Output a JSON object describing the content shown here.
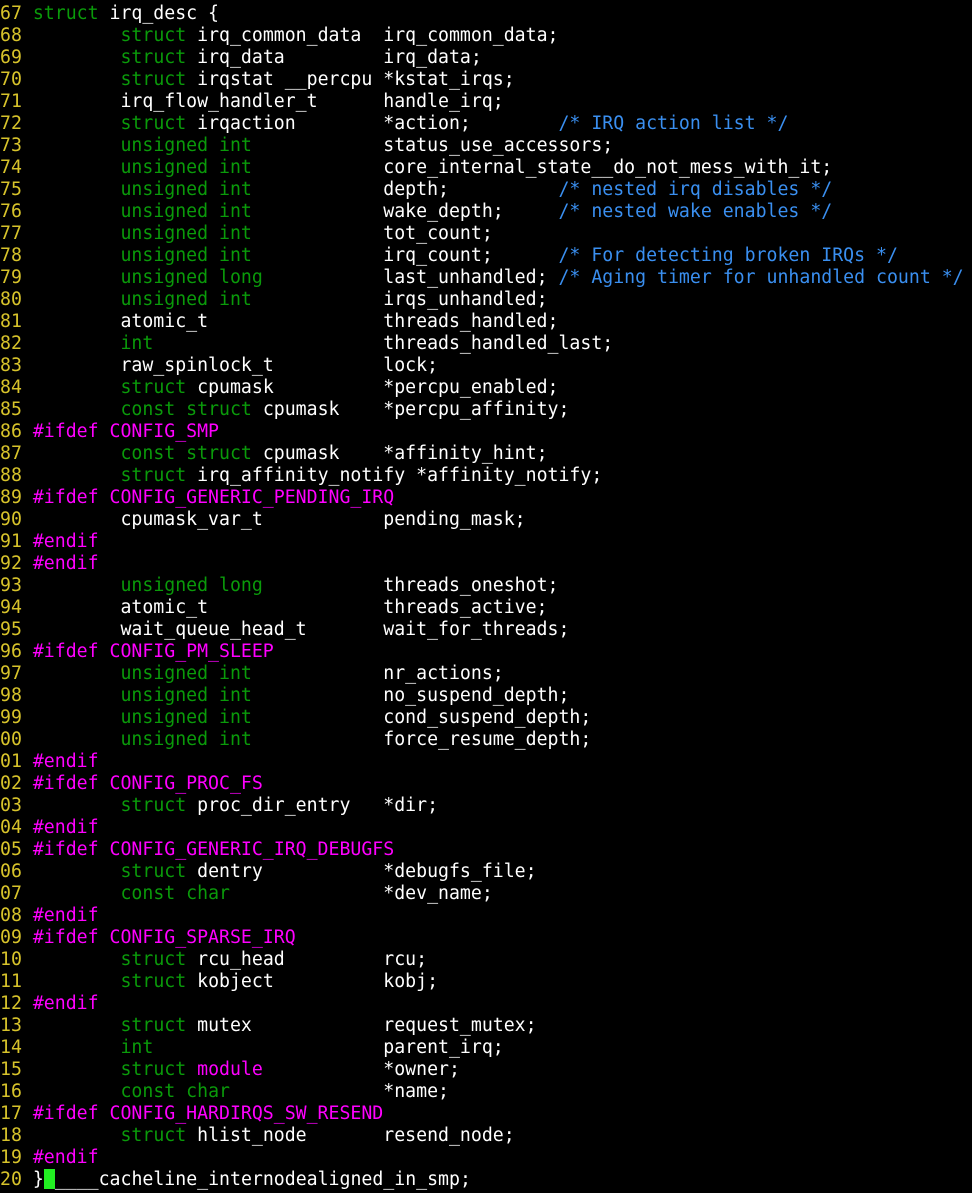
{
  "editor": {
    "mode": "vim",
    "colors": {
      "background": "#000000",
      "line_number": "#d7c32b",
      "keyword": "#0a9a0a",
      "preprocessor": "#ff00ff",
      "comment": "#3a8ff0",
      "text": "#ffffff",
      "cursor": "#22ee22"
    },
    "lines": [
      {
        "n": "67",
        "segs": [
          [
            "kw",
            "struct"
          ],
          [
            "tx",
            " irq_desc {"
          ]
        ]
      },
      {
        "n": "68",
        "segs": [
          [
            "tx",
            "        "
          ],
          [
            "kw",
            "struct"
          ],
          [
            "tx",
            " irq_common_data  irq_common_data;"
          ]
        ]
      },
      {
        "n": "69",
        "segs": [
          [
            "tx",
            "        "
          ],
          [
            "kw",
            "struct"
          ],
          [
            "tx",
            " irq_data         irq_data;"
          ]
        ]
      },
      {
        "n": "70",
        "segs": [
          [
            "tx",
            "        "
          ],
          [
            "kw",
            "struct"
          ],
          [
            "tx",
            " irqstat __percpu *kstat_irqs;"
          ]
        ]
      },
      {
        "n": "71",
        "segs": [
          [
            "tx",
            "        irq_flow_handler_t      handle_irq;"
          ]
        ]
      },
      {
        "n": "72",
        "segs": [
          [
            "tx",
            "        "
          ],
          [
            "kw",
            "struct"
          ],
          [
            "tx",
            " irqaction        *action;        "
          ],
          [
            "cm",
            "/* IRQ action list */"
          ]
        ]
      },
      {
        "n": "73",
        "segs": [
          [
            "tx",
            "        "
          ],
          [
            "kw",
            "unsigned int"
          ],
          [
            "tx",
            "            status_use_accessors;"
          ]
        ]
      },
      {
        "n": "74",
        "segs": [
          [
            "tx",
            "        "
          ],
          [
            "kw",
            "unsigned int"
          ],
          [
            "tx",
            "            core_internal_state__do_not_mess_with_it;"
          ]
        ]
      },
      {
        "n": "75",
        "segs": [
          [
            "tx",
            "        "
          ],
          [
            "kw",
            "unsigned int"
          ],
          [
            "tx",
            "            depth;          "
          ],
          [
            "cm",
            "/* nested irq disables */"
          ]
        ]
      },
      {
        "n": "76",
        "segs": [
          [
            "tx",
            "        "
          ],
          [
            "kw",
            "unsigned int"
          ],
          [
            "tx",
            "            wake_depth;     "
          ],
          [
            "cm",
            "/* nested wake enables */"
          ]
        ]
      },
      {
        "n": "77",
        "segs": [
          [
            "tx",
            "        "
          ],
          [
            "kw",
            "unsigned int"
          ],
          [
            "tx",
            "            tot_count;"
          ]
        ]
      },
      {
        "n": "78",
        "segs": [
          [
            "tx",
            "        "
          ],
          [
            "kw",
            "unsigned int"
          ],
          [
            "tx",
            "            irq_count;      "
          ],
          [
            "cm",
            "/* For detecting broken IRQs */"
          ]
        ]
      },
      {
        "n": "79",
        "segs": [
          [
            "tx",
            "        "
          ],
          [
            "kw",
            "unsigned long"
          ],
          [
            "tx",
            "           last_unhandled; "
          ],
          [
            "cm",
            "/* Aging timer for unhandled count */"
          ]
        ]
      },
      {
        "n": "80",
        "segs": [
          [
            "tx",
            "        "
          ],
          [
            "kw",
            "unsigned int"
          ],
          [
            "tx",
            "            irqs_unhandled;"
          ]
        ]
      },
      {
        "n": "81",
        "segs": [
          [
            "tx",
            "        atomic_t                threads_handled;"
          ]
        ]
      },
      {
        "n": "82",
        "segs": [
          [
            "tx",
            "        "
          ],
          [
            "kw",
            "int"
          ],
          [
            "tx",
            "                     threads_handled_last;"
          ]
        ]
      },
      {
        "n": "83",
        "segs": [
          [
            "tx",
            "        raw_spinlock_t          lock;"
          ]
        ]
      },
      {
        "n": "84",
        "segs": [
          [
            "tx",
            "        "
          ],
          [
            "kw",
            "struct"
          ],
          [
            "tx",
            " cpumask          *percpu_enabled;"
          ]
        ]
      },
      {
        "n": "85",
        "segs": [
          [
            "tx",
            "        "
          ],
          [
            "kw",
            "const struct"
          ],
          [
            "tx",
            " cpumask    *percpu_affinity;"
          ]
        ]
      },
      {
        "n": "86",
        "segs": [
          [
            "pp",
            "#ifdef CONFIG_SMP"
          ]
        ]
      },
      {
        "n": "87",
        "segs": [
          [
            "tx",
            "        "
          ],
          [
            "kw",
            "const struct"
          ],
          [
            "tx",
            " cpumask    *affinity_hint;"
          ]
        ]
      },
      {
        "n": "88",
        "segs": [
          [
            "tx",
            "        "
          ],
          [
            "kw",
            "struct"
          ],
          [
            "tx",
            " irq_affinity_notify *affinity_notify;"
          ]
        ]
      },
      {
        "n": "89",
        "segs": [
          [
            "pp",
            "#ifdef CONFIG_GENERIC_PENDING_IRQ"
          ]
        ]
      },
      {
        "n": "90",
        "segs": [
          [
            "tx",
            "        cpumask_var_t           pending_mask;"
          ]
        ]
      },
      {
        "n": "91",
        "segs": [
          [
            "pp",
            "#endif"
          ]
        ]
      },
      {
        "n": "92",
        "segs": [
          [
            "pp",
            "#endif"
          ]
        ]
      },
      {
        "n": "93",
        "segs": [
          [
            "tx",
            "        "
          ],
          [
            "kw",
            "unsigned long"
          ],
          [
            "tx",
            "           threads_oneshot;"
          ]
        ]
      },
      {
        "n": "94",
        "segs": [
          [
            "tx",
            "        atomic_t                threads_active;"
          ]
        ]
      },
      {
        "n": "95",
        "segs": [
          [
            "tx",
            "        wait_queue_head_t       wait_for_threads;"
          ]
        ]
      },
      {
        "n": "96",
        "segs": [
          [
            "pp",
            "#ifdef CONFIG_PM_SLEEP"
          ]
        ]
      },
      {
        "n": "97",
        "segs": [
          [
            "tx",
            "        "
          ],
          [
            "kw",
            "unsigned int"
          ],
          [
            "tx",
            "            nr_actions;"
          ]
        ]
      },
      {
        "n": "98",
        "segs": [
          [
            "tx",
            "        "
          ],
          [
            "kw",
            "unsigned int"
          ],
          [
            "tx",
            "            no_suspend_depth;"
          ]
        ]
      },
      {
        "n": "99",
        "segs": [
          [
            "tx",
            "        "
          ],
          [
            "kw",
            "unsigned int"
          ],
          [
            "tx",
            "            cond_suspend_depth;"
          ]
        ]
      },
      {
        "n": "00",
        "segs": [
          [
            "tx",
            "        "
          ],
          [
            "kw",
            "unsigned int"
          ],
          [
            "tx",
            "            force_resume_depth;"
          ]
        ]
      },
      {
        "n": "01",
        "segs": [
          [
            "pp",
            "#endif"
          ]
        ]
      },
      {
        "n": "02",
        "segs": [
          [
            "pp",
            "#ifdef CONFIG_PROC_FS"
          ]
        ]
      },
      {
        "n": "03",
        "segs": [
          [
            "tx",
            "        "
          ],
          [
            "kw",
            "struct"
          ],
          [
            "tx",
            " proc_dir_entry   *dir;"
          ]
        ]
      },
      {
        "n": "04",
        "segs": [
          [
            "pp",
            "#endif"
          ]
        ]
      },
      {
        "n": "05",
        "segs": [
          [
            "pp",
            "#ifdef CONFIG_GENERIC_IRQ_DEBUGFS"
          ]
        ]
      },
      {
        "n": "06",
        "segs": [
          [
            "tx",
            "        "
          ],
          [
            "kw",
            "struct"
          ],
          [
            "tx",
            " dentry           *debugfs_file;"
          ]
        ]
      },
      {
        "n": "07",
        "segs": [
          [
            "tx",
            "        "
          ],
          [
            "kw",
            "const char"
          ],
          [
            "tx",
            "              *dev_name;"
          ]
        ]
      },
      {
        "n": "08",
        "segs": [
          [
            "pp",
            "#endif"
          ]
        ]
      },
      {
        "n": "09",
        "segs": [
          [
            "pp",
            "#ifdef CONFIG_SPARSE_IRQ"
          ]
        ]
      },
      {
        "n": "10",
        "segs": [
          [
            "tx",
            "        "
          ],
          [
            "kw",
            "struct"
          ],
          [
            "tx",
            " rcu_head         rcu;"
          ]
        ]
      },
      {
        "n": "11",
        "segs": [
          [
            "tx",
            "        "
          ],
          [
            "kw",
            "struct"
          ],
          [
            "tx",
            " kobject          kobj;"
          ]
        ]
      },
      {
        "n": "12",
        "segs": [
          [
            "pp",
            "#endif"
          ]
        ]
      },
      {
        "n": "13",
        "segs": [
          [
            "tx",
            "        "
          ],
          [
            "kw",
            "struct"
          ],
          [
            "tx",
            " mutex            request_mutex;"
          ]
        ]
      },
      {
        "n": "14",
        "segs": [
          [
            "tx",
            "        "
          ],
          [
            "kw",
            "int"
          ],
          [
            "tx",
            "                     parent_irq;"
          ]
        ]
      },
      {
        "n": "15",
        "segs": [
          [
            "tx",
            "        "
          ],
          [
            "kw",
            "struct"
          ],
          [
            "tx",
            " "
          ],
          [
            "pp",
            "module"
          ],
          [
            "tx",
            "           *owner;"
          ]
        ]
      },
      {
        "n": "16",
        "segs": [
          [
            "tx",
            "        "
          ],
          [
            "kw",
            "const char"
          ],
          [
            "tx",
            "              *name;"
          ]
        ]
      },
      {
        "n": "17",
        "segs": [
          [
            "pp",
            "#ifdef CONFIG_HARDIRQS_SW_RESEND"
          ]
        ]
      },
      {
        "n": "18",
        "segs": [
          [
            "tx",
            "        "
          ],
          [
            "kw",
            "struct"
          ],
          [
            "tx",
            " hlist_node       resend_node;"
          ]
        ]
      },
      {
        "n": "19",
        "segs": [
          [
            "pp",
            "#endif"
          ]
        ]
      },
      {
        "n": "20",
        "segs": [
          [
            "tx",
            "}"
          ],
          [
            "cursor",
            ""
          ],
          [
            "tx",
            "____cacheline_internodealigned_in_smp;"
          ]
        ]
      }
    ]
  }
}
